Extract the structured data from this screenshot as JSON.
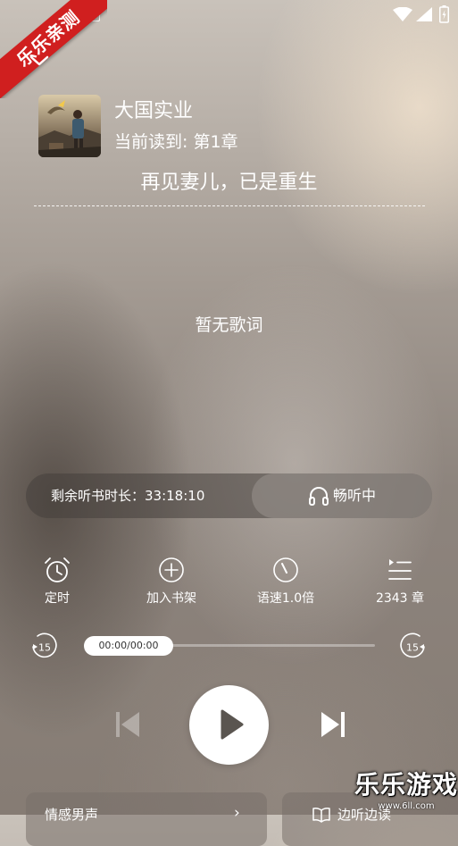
{
  "watermark": {
    "ribbon_text": "乐乐亲测"
  },
  "status_bar": {
    "app_icon": "A"
  },
  "book": {
    "title": "大国实业",
    "current_chapter": "当前读到: 第1章",
    "chapter_name": "再见妻儿，已是重生"
  },
  "lyrics": {
    "empty_text": "暂无歌词"
  },
  "listening": {
    "remaining_time": "剩余听书时长：33:18:10",
    "button_label": "畅听中"
  },
  "actions": [
    {
      "label": "定时",
      "icon": "alarm-clock-icon"
    },
    {
      "label": "加入书架",
      "icon": "add-circle-icon"
    },
    {
      "label": "语速1.0倍",
      "icon": "speedometer-icon"
    },
    {
      "label": "2343 章",
      "icon": "chapter-list-icon"
    }
  ],
  "progress": {
    "time": "00:00/00:00",
    "value": 0,
    "rewind_seconds": "15",
    "forward_seconds": "15"
  },
  "cards": {
    "left_label": "情感男声",
    "left_arrow": "›",
    "right_label": "边听边读"
  },
  "logo": {
    "text": "乐乐游戏",
    "url": "www.6ll.com"
  }
}
